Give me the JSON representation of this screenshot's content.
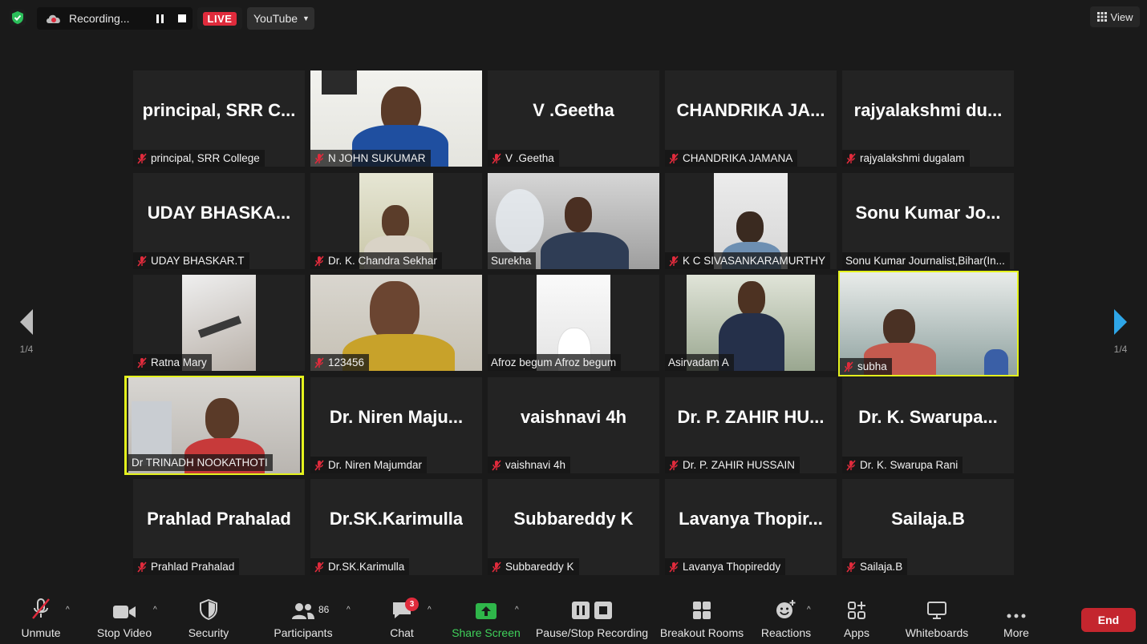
{
  "topbar": {
    "recording_label": "Recording...",
    "live_label": "LIVE",
    "platform_label": "YouTube",
    "view_label": "View"
  },
  "pagination": {
    "left": "1/4",
    "right": "1/4"
  },
  "tiles": [
    {
      "big": "principal,  SRR  C...",
      "label": "principal, SRR College"
    },
    {
      "big": "",
      "label": "N JOHN SUKUMAR"
    },
    {
      "big": "V .Geetha",
      "label": "V .Geetha"
    },
    {
      "big": "CHANDRIKA  JA...",
      "label": "CHANDRIKA JAMANA"
    },
    {
      "big": "rajyalakshmi  du...",
      "label": "rajyalakshmi dugalam"
    },
    {
      "big": "UDAY  BHASKA...",
      "label": "UDAY BHASKAR.T"
    },
    {
      "big": "",
      "label": "Dr. K. Chandra Sekhar"
    },
    {
      "big": "",
      "label": "Surekha"
    },
    {
      "big": "",
      "label": "K C SIVASANKARAMURTHY"
    },
    {
      "big": "Sonu  Kumar  Jo...",
      "label": "Sonu Kumar Journalist,Bihar(In..."
    },
    {
      "big": "",
      "label": "Ratna Mary"
    },
    {
      "big": "",
      "label": "123456"
    },
    {
      "big": "",
      "label": "Afroz begum Afroz begum"
    },
    {
      "big": "",
      "label": "Asirvadam A"
    },
    {
      "big": "",
      "label": "subha"
    },
    {
      "big": "",
      "label": "Dr TRINADH NOOKATHOTI"
    },
    {
      "big": "Dr.  Niren  Maju...",
      "label": "Dr. Niren Majumdar"
    },
    {
      "big": "vaishnavi 4h",
      "label": "vaishnavi 4h"
    },
    {
      "big": "Dr.  P.  ZAHIR  HU...",
      "label": "Dr. P. ZAHIR HUSSAIN"
    },
    {
      "big": "Dr.  K.  Swarupa...",
      "label": "Dr. K. Swarupa Rani"
    },
    {
      "big": "Prahlad Prahalad",
      "label": "Prahlad Prahalad"
    },
    {
      "big": "Dr.SK.Karimulla",
      "label": "Dr.SK.Karimulla"
    },
    {
      "big": "Subbareddy K",
      "label": "Subbareddy K"
    },
    {
      "big": "Lavanya  Thopir...",
      "label": "Lavanya Thopireddy"
    },
    {
      "big": "Sailaja.B",
      "label": "Sailaja.B"
    }
  ],
  "toolbar": {
    "unmute": "Unmute",
    "stop_video": "Stop Video",
    "security": "Security",
    "participants": "Participants",
    "participants_count": "86",
    "chat": "Chat",
    "chat_badge": "3",
    "share_screen": "Share Screen",
    "pause_stop_recording": "Pause/Stop Recording",
    "breakout_rooms": "Breakout Rooms",
    "reactions": "Reactions",
    "apps": "Apps",
    "whiteboards": "Whiteboards",
    "more": "More",
    "end": "End"
  },
  "colors": {
    "accent_green": "#3fd15a",
    "live_red": "#e02b3c",
    "end_red": "#c4262e",
    "active_speaker": "#e4f21d",
    "nav_blue": "#2ea6e8"
  }
}
